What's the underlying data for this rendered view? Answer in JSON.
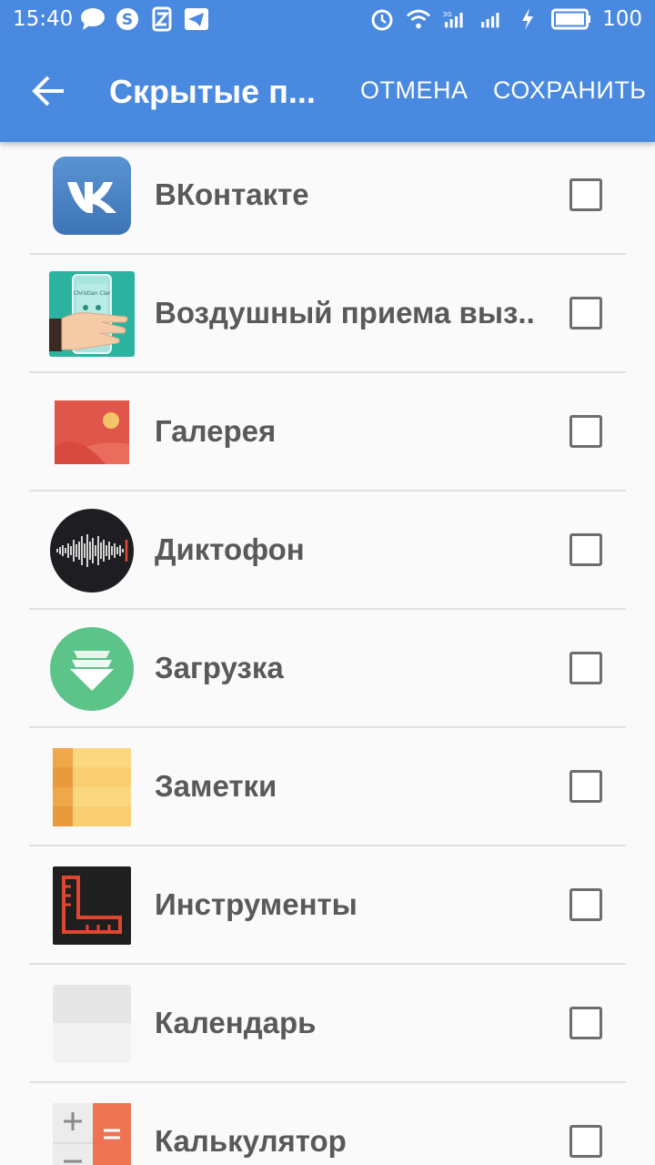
{
  "status_bar": {
    "time": "15:40",
    "battery": "100",
    "left_icons": [
      "chat-icon",
      "skype-icon",
      "zen-icon",
      "telegram-icon"
    ],
    "right_icons": [
      "alarm-icon",
      "wifi-icon",
      "signal-3g-icon",
      "signal-icon",
      "charging-icon",
      "battery-icon"
    ]
  },
  "toolbar": {
    "title": "Скрытые п...",
    "cancel_label": "ОТМЕНА",
    "save_label": "СОХРАНИТЬ",
    "color": "#4a89e0"
  },
  "apps": [
    {
      "name": "ВКонтакте",
      "icon": "vk-icon",
      "checked": false
    },
    {
      "name": "Воздушный приема выз..",
      "icon": "air-call-icon",
      "checked": false
    },
    {
      "name": "Галерея",
      "icon": "gallery-icon",
      "checked": false
    },
    {
      "name": "Диктофон",
      "icon": "recorder-icon",
      "checked": false
    },
    {
      "name": "Загрузка",
      "icon": "download-icon",
      "checked": false
    },
    {
      "name": "Заметки",
      "icon": "notes-icon",
      "checked": false
    },
    {
      "name": "Инструменты",
      "icon": "tools-icon",
      "checked": false
    },
    {
      "name": "Календарь",
      "icon": "calendar-icon",
      "checked": false
    },
    {
      "name": "Калькулятор",
      "icon": "calculator-icon",
      "checked": false
    }
  ]
}
